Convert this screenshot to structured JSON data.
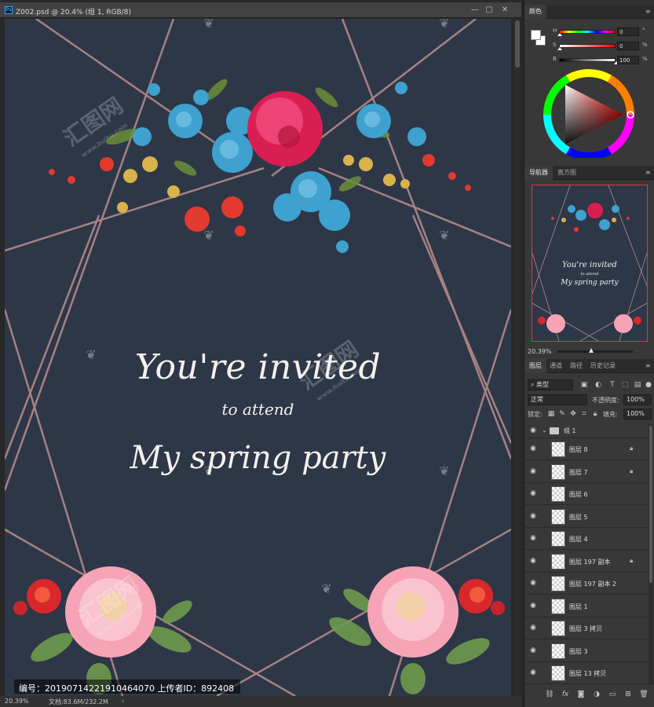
{
  "document": {
    "title": "Z002.psd @ 20.4% (组 1, RGB/8)",
    "window_controls": [
      "—",
      "▢",
      "✕"
    ]
  },
  "invitation": {
    "line1": "You're invited",
    "line2": "to attend",
    "line3": "My spring party"
  },
  "watermark": {
    "brand": "汇图网",
    "url": "www.huitu.com"
  },
  "credit_bar": "编号：20190714221910464070 上传者ID：892408",
  "status_bar": {
    "zoom": "20.39%",
    "doc_info": "文档:83.6M/232.2M",
    "arrow": "›"
  },
  "color_panel": {
    "tab": "颜色",
    "rows": [
      {
        "label": "H",
        "value": "0",
        "unit": "°"
      },
      {
        "label": "S",
        "value": "0",
        "unit": "%"
      },
      {
        "label": "B",
        "value": "100",
        "unit": "%"
      }
    ]
  },
  "navigator_panel": {
    "tabs": [
      "导航器",
      "直方图"
    ],
    "thumb_text": [
      "You're invited",
      "to attend",
      "My spring party"
    ],
    "zoom": "20.39%"
  },
  "layers_panel": {
    "tabs": [
      "图层",
      "通道",
      "路径",
      "历史记录"
    ],
    "filter_kind": "类型",
    "blend_mode": "正常",
    "opacity_label": "不透明度:",
    "opacity_value": "100%",
    "lock_label": "锁定:",
    "fill_label": "填充:",
    "fill_value": "100%",
    "layers": [
      {
        "name": "组 1",
        "type": "group",
        "locked": false
      },
      {
        "name": "图层 8",
        "type": "layer",
        "locked": true
      },
      {
        "name": "图层 7",
        "type": "layer",
        "locked": true
      },
      {
        "name": "图层 6",
        "type": "layer",
        "locked": false
      },
      {
        "name": "图层 5",
        "type": "layer",
        "locked": false
      },
      {
        "name": "图层 4",
        "type": "layer",
        "locked": false
      },
      {
        "name": "图层 197 副本",
        "type": "layer",
        "locked": true
      },
      {
        "name": "图层 197 副本 2",
        "type": "layer",
        "locked": false
      },
      {
        "name": "图层 1",
        "type": "layer",
        "locked": false
      },
      {
        "name": "图层 3 拷贝",
        "type": "layer",
        "locked": false
      },
      {
        "name": "图层 3",
        "type": "layer",
        "locked": false
      },
      {
        "name": "图层 13 拷贝",
        "type": "layer",
        "locked": false
      }
    ],
    "footer_icons": [
      "link-icon",
      "fx-icon",
      "mask-icon",
      "adjustment-icon",
      "folder-icon",
      "new-layer-icon",
      "trash-icon"
    ]
  },
  "colors": {
    "canvas_bg": "#2d3747",
    "frame_line": "#b48a8a",
    "text": "#f4f1ee",
    "accent_nav_border": "#e03a3a"
  }
}
